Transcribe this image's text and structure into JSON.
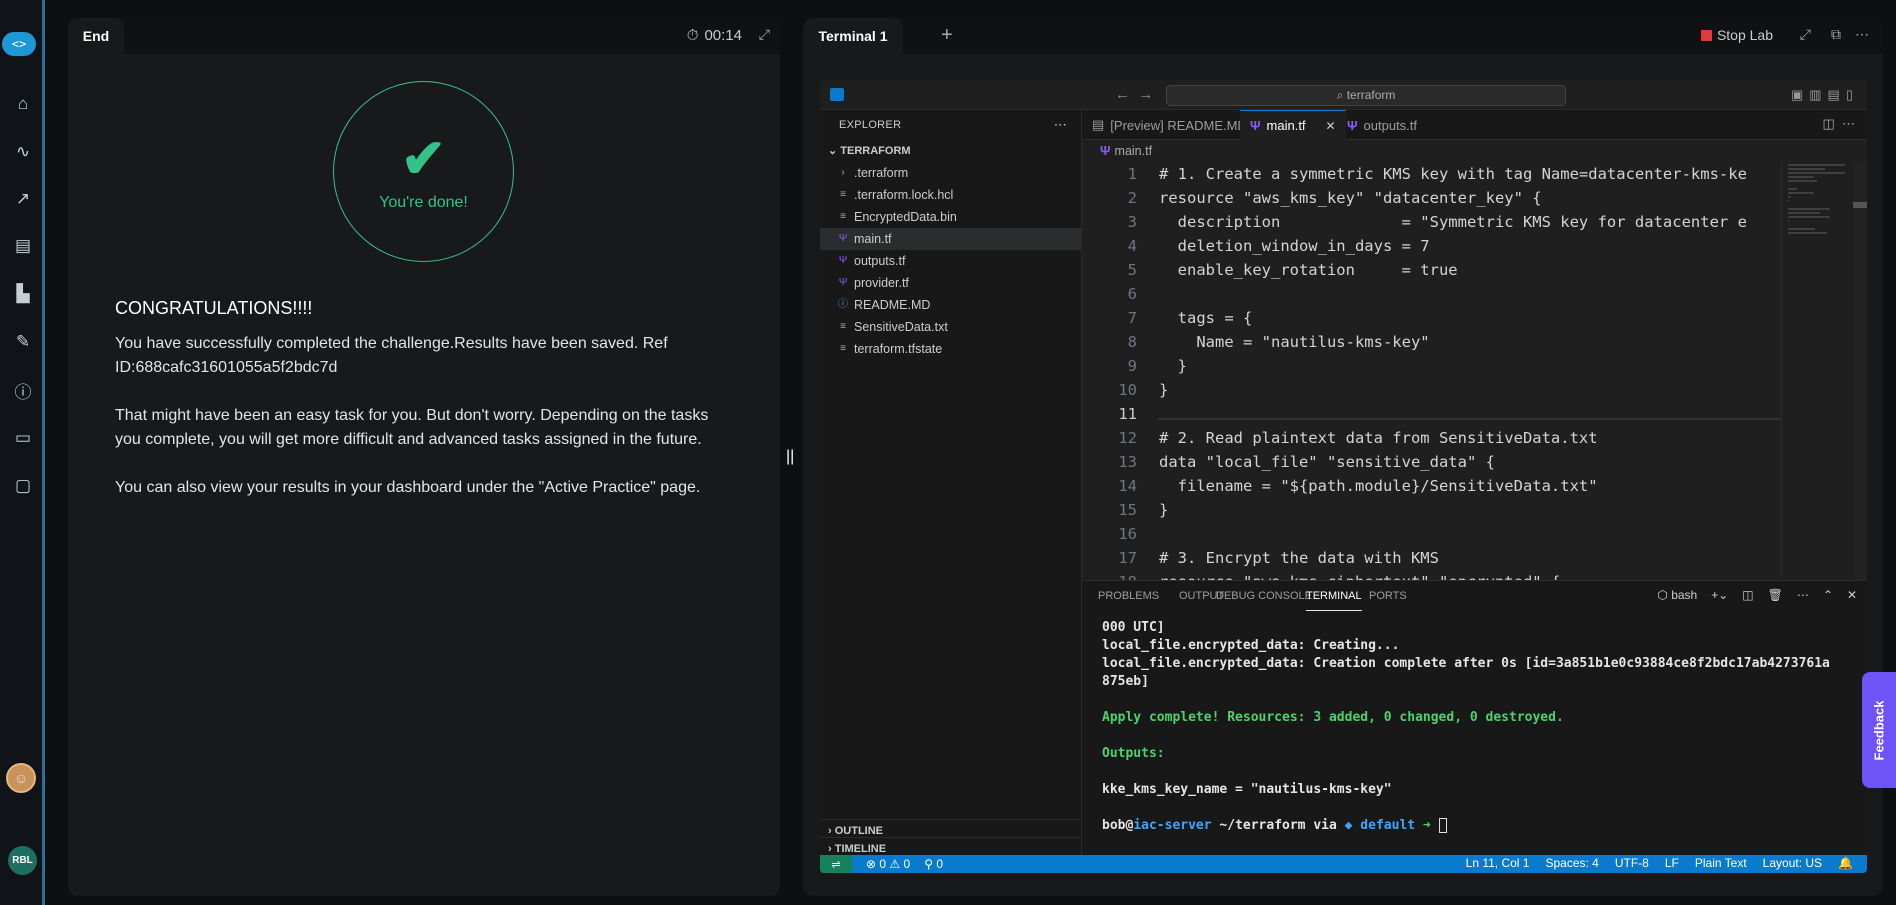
{
  "rail": {
    "icons": [
      "code-logo-icon",
      "home-icon",
      "route-icon",
      "chart-icon",
      "film-icon",
      "podium-icon",
      "edit-icon",
      "info-icon",
      "book-icon",
      "chat-icon"
    ],
    "initials": "RBL"
  },
  "left": {
    "tab": "End",
    "timer": "00:14",
    "done": "You're done!",
    "heading": "CONGRATULATIONS!!!!",
    "p1": "You have successfully completed the challenge.Results have been saved. Ref ID:688cafc31601055a5f2bdc7d",
    "p2": "That might have been an easy task for you. But don't worry. Depending on the tasks you complete, you will get more difficult and advanced tasks assigned in the future.",
    "p3": "You can also view your results in your dashboard under the \"Active Practice\" page."
  },
  "right": {
    "tab": "Terminal 1",
    "stop": "Stop Lab"
  },
  "vscode": {
    "search": "terraform",
    "explorer": {
      "title": "EXPLORER",
      "root": "TERRAFORM",
      "files": [
        {
          "name": ".terraform",
          "icon": "folder"
        },
        {
          "name": ".terraform.lock.hcl",
          "icon": "lines"
        },
        {
          "name": "EncryptedData.bin",
          "icon": "lines"
        },
        {
          "name": "main.tf",
          "icon": "tf"
        },
        {
          "name": "outputs.tf",
          "icon": "tf"
        },
        {
          "name": "provider.tf",
          "icon": "tf"
        },
        {
          "name": "README.MD",
          "icon": "info"
        },
        {
          "name": "SensitiveData.txt",
          "icon": "lines"
        },
        {
          "name": "terraform.tfstate",
          "icon": "lines"
        }
      ],
      "outline": "OUTLINE",
      "timeline": "TIMELINE"
    },
    "tabs": [
      {
        "label": "[Preview] README.MD"
      },
      {
        "label": "main.tf"
      },
      {
        "label": "outputs.tf"
      }
    ],
    "breadcrumb": "main.tf",
    "code": [
      "# 1. Create a symmetric KMS key with tag Name=datacenter-kms-ke",
      "resource \"aws_kms_key\" \"datacenter_key\" {",
      "  description             = \"Symmetric KMS key for datacenter e",
      "  deletion_window_in_days = 7",
      "  enable_key_rotation     = true",
      "",
      "  tags = {",
      "    Name = \"nautilus-kms-key\"",
      "  }",
      "}",
      "",
      "# 2. Read plaintext data from SensitiveData.txt",
      "data \"local_file\" \"sensitive_data\" {",
      "  filename = \"${path.module}/SensitiveData.txt\"",
      "}",
      "",
      "# 3. Encrypt the data with KMS",
      "resource \"aws_kms_ciphertext\" \"encrypted\" {"
    ],
    "panel_tabs": [
      "PROBLEMS",
      "OUTPUT",
      "DEBUG CONSOLE",
      "TERMINAL",
      "PORTS"
    ],
    "shell": "bash",
    "terminal": {
      "l1": "000 UTC]",
      "l2": "local_file.encrypted_data: Creating...",
      "l3": "local_file.encrypted_data: Creation complete after 0s [id=3a851b1e0c93884ce8f2bdc17ab4273761a",
      "l4": "875eb]",
      "apply": "Apply complete! Resources: 3 added, 0 changed, 0 destroyed.",
      "outputs": "Outputs:",
      "kv": "kke_kms_key_name = \"nautilus-kms-key\"",
      "user": "bob",
      "host": "iac-server",
      "path": " ~/terraform via ",
      "ctx": "◆ default",
      "arrow": " ➜ "
    },
    "status": {
      "errors": "0",
      "warnings": "0",
      "ports": "0",
      "pos": "Ln 11, Col 1",
      "spaces": "Spaces: 4",
      "enc": "UTF-8",
      "eol": "LF",
      "lang": "Plain Text",
      "layout": "Layout: US"
    }
  },
  "feedback": "Feedback"
}
